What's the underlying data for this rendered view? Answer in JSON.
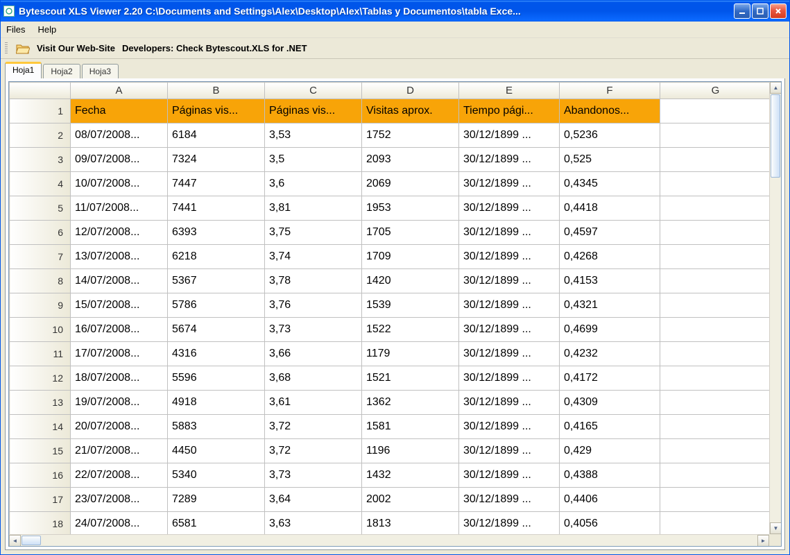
{
  "titlebar": {
    "title": "Bytescout XLS Viewer 2.20 C:\\Documents and Settings\\Alex\\Desktop\\Alex\\Tablas y Documentos\\tabla Exce..."
  },
  "menubar": {
    "files": "Files",
    "help": "Help"
  },
  "toolbar": {
    "visit": "Visit Our Web-Site",
    "developers": "Developers: Check Bytescout.XLS for .NET"
  },
  "tabs": [
    "Hoja1",
    "Hoja2",
    "Hoja3"
  ],
  "columns": [
    "",
    "A",
    "B",
    "C",
    "D",
    "E",
    "F",
    "G"
  ],
  "header_row": [
    "Fecha",
    "Páginas vis...",
    "Páginas vis...",
    "Visitas aprox.",
    "Tiempo pági...",
    "Abandonos...",
    ""
  ],
  "rows": [
    [
      "08/07/2008...",
      "6184",
      "3,53",
      "1752",
      "30/12/1899 ...",
      "0,5236",
      ""
    ],
    [
      "09/07/2008...",
      "7324",
      "3,5",
      "2093",
      "30/12/1899 ...",
      "0,525",
      ""
    ],
    [
      "10/07/2008...",
      "7447",
      "3,6",
      "2069",
      "30/12/1899 ...",
      "0,4345",
      ""
    ],
    [
      "11/07/2008...",
      "7441",
      "3,81",
      "1953",
      "30/12/1899 ...",
      "0,4418",
      ""
    ],
    [
      "12/07/2008...",
      "6393",
      "3,75",
      "1705",
      "30/12/1899 ...",
      "0,4597",
      ""
    ],
    [
      "13/07/2008...",
      "6218",
      "3,74",
      "1709",
      "30/12/1899 ...",
      "0,4268",
      ""
    ],
    [
      "14/07/2008...",
      "5367",
      "3,78",
      "1420",
      "30/12/1899 ...",
      "0,4153",
      ""
    ],
    [
      "15/07/2008...",
      "5786",
      "3,76",
      "1539",
      "30/12/1899 ...",
      "0,4321",
      ""
    ],
    [
      "16/07/2008...",
      "5674",
      "3,73",
      "1522",
      "30/12/1899 ...",
      "0,4699",
      ""
    ],
    [
      "17/07/2008...",
      "4316",
      "3,66",
      "1179",
      "30/12/1899 ...",
      "0,4232",
      ""
    ],
    [
      "18/07/2008...",
      "5596",
      "3,68",
      "1521",
      "30/12/1899 ...",
      "0,4172",
      ""
    ],
    [
      "19/07/2008...",
      "4918",
      "3,61",
      "1362",
      "30/12/1899 ...",
      "0,4309",
      ""
    ],
    [
      "20/07/2008...",
      "5883",
      "3,72",
      "1581",
      "30/12/1899 ...",
      "0,4165",
      ""
    ],
    [
      "21/07/2008...",
      "4450",
      "3,72",
      "1196",
      "30/12/1899 ...",
      "0,429",
      ""
    ],
    [
      "22/07/2008...",
      "5340",
      "3,73",
      "1432",
      "30/12/1899 ...",
      "0,4388",
      ""
    ],
    [
      "23/07/2008...",
      "7289",
      "3,64",
      "2002",
      "30/12/1899 ...",
      "0,4406",
      ""
    ],
    [
      "24/07/2008...",
      "6581",
      "3,63",
      "1813",
      "30/12/1899 ...",
      "0,4056",
      ""
    ]
  ]
}
